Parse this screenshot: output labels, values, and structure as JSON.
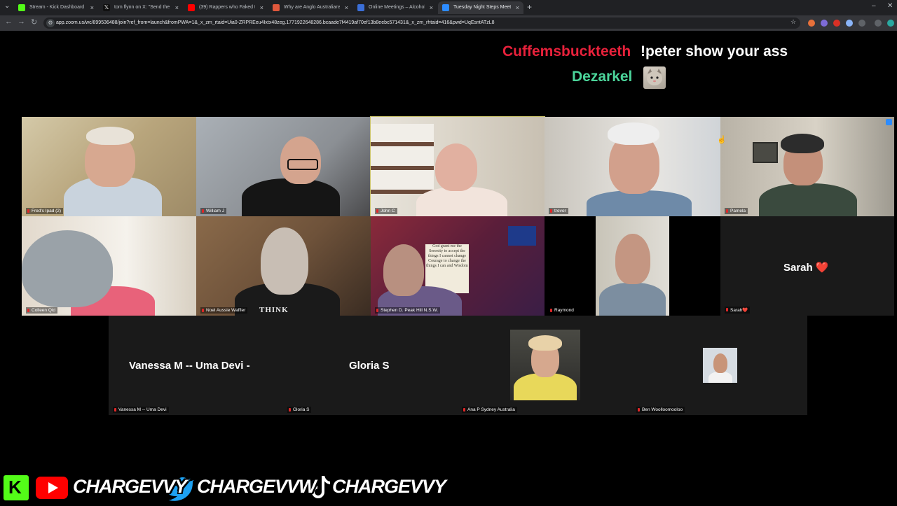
{
  "browser": {
    "tabs": [
      {
        "title": "Stream - Kick Dashboard",
        "icon": "kick-icon",
        "color": "#53fc18"
      },
      {
        "title": "tom flynn on X: \"Send the tras",
        "icon": "x-icon",
        "color": "#ffffff"
      },
      {
        "title": "(39) Rappers who Faked their li",
        "icon": "youtube-icon",
        "color": "#ff0000"
      },
      {
        "title": "Why are Anglo Australians \"Au",
        "icon": "site-icon",
        "color": "#e0583c"
      },
      {
        "title": "Online Meetings – Alcoholics A",
        "icon": "aa-icon",
        "color": "#3b6fd8"
      },
      {
        "title": "Tuesday Night Steps Meeti",
        "icon": "zoom-icon",
        "color": "#2d8cff"
      }
    ],
    "url": "app.zoom.us/wc/899536488/join?ref_from=launch&fromPWA=1&_x_zm_rtaid=Uia0-ZRPREeu4Ixtx48zeg.1771922648286.bcaade7f4419af70ef13b8eebc571431&_x_zm_rhtaid=416&pwd=UqEsntATzL8"
  },
  "chat": [
    {
      "user": "Cuffemsbuckteeth",
      "message": "!peter show your ass",
      "user_color": "#e8213b"
    },
    {
      "user": "Dezarkel",
      "message": "",
      "user_color": "#4bd49a"
    }
  ],
  "participants_row1": [
    {
      "name": "Fred's Ipad (2)"
    },
    {
      "name": "William J"
    },
    {
      "name": "John C"
    },
    {
      "name": "trevor"
    },
    {
      "name": "Pamela"
    }
  ],
  "participants_row2": [
    {
      "name": "Colleen Qld"
    },
    {
      "name": "Noel Aussie Waffler"
    },
    {
      "name": "Stephen D. Peak Hill N.S.W."
    },
    {
      "name": "Raymond"
    },
    {
      "name": "Sarah❤️",
      "display": "Sarah ❤️"
    }
  ],
  "participants_row3": [
    {
      "name": "Vanessa M -- Uma Devi",
      "display": "Vanessa M -- Uma Devi -"
    },
    {
      "name": "Gloria S",
      "display": "Gloria S"
    },
    {
      "name": "Ana P Sydney Australia"
    },
    {
      "name": "Ben Woolloomooloo"
    }
  ],
  "shirt_text": "THINK",
  "sign_text": "God grant me the Serenity to accept the things I cannot change Courage to change the things I can and Wisdom",
  "overlay": {
    "handle_1": "CHARGEVVY",
    "handle_2": "CHARGEVVW",
    "handle_3": "CHARGEVVY"
  }
}
